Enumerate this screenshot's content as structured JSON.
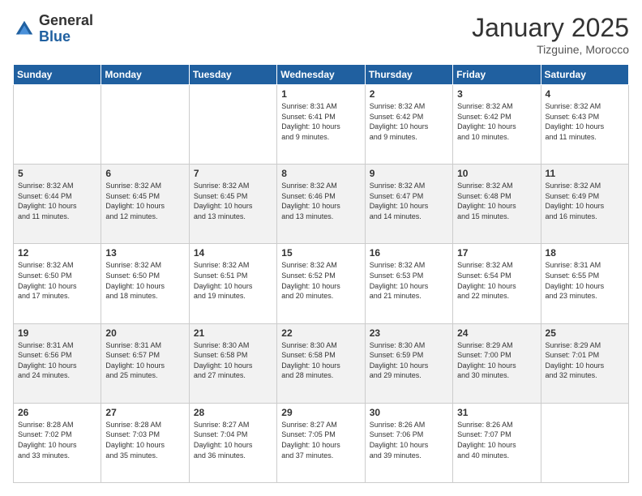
{
  "header": {
    "logo_general": "General",
    "logo_blue": "Blue",
    "month_title": "January 2025",
    "location": "Tizguine, Morocco"
  },
  "days_of_week": [
    "Sunday",
    "Monday",
    "Tuesday",
    "Wednesday",
    "Thursday",
    "Friday",
    "Saturday"
  ],
  "weeks": [
    {
      "shaded": false,
      "days": [
        {
          "num": "",
          "info": ""
        },
        {
          "num": "",
          "info": ""
        },
        {
          "num": "",
          "info": ""
        },
        {
          "num": "1",
          "info": "Sunrise: 8:31 AM\nSunset: 6:41 PM\nDaylight: 10 hours\nand 9 minutes."
        },
        {
          "num": "2",
          "info": "Sunrise: 8:32 AM\nSunset: 6:42 PM\nDaylight: 10 hours\nand 9 minutes."
        },
        {
          "num": "3",
          "info": "Sunrise: 8:32 AM\nSunset: 6:42 PM\nDaylight: 10 hours\nand 10 minutes."
        },
        {
          "num": "4",
          "info": "Sunrise: 8:32 AM\nSunset: 6:43 PM\nDaylight: 10 hours\nand 11 minutes."
        }
      ]
    },
    {
      "shaded": true,
      "days": [
        {
          "num": "5",
          "info": "Sunrise: 8:32 AM\nSunset: 6:44 PM\nDaylight: 10 hours\nand 11 minutes."
        },
        {
          "num": "6",
          "info": "Sunrise: 8:32 AM\nSunset: 6:45 PM\nDaylight: 10 hours\nand 12 minutes."
        },
        {
          "num": "7",
          "info": "Sunrise: 8:32 AM\nSunset: 6:45 PM\nDaylight: 10 hours\nand 13 minutes."
        },
        {
          "num": "8",
          "info": "Sunrise: 8:32 AM\nSunset: 6:46 PM\nDaylight: 10 hours\nand 13 minutes."
        },
        {
          "num": "9",
          "info": "Sunrise: 8:32 AM\nSunset: 6:47 PM\nDaylight: 10 hours\nand 14 minutes."
        },
        {
          "num": "10",
          "info": "Sunrise: 8:32 AM\nSunset: 6:48 PM\nDaylight: 10 hours\nand 15 minutes."
        },
        {
          "num": "11",
          "info": "Sunrise: 8:32 AM\nSunset: 6:49 PM\nDaylight: 10 hours\nand 16 minutes."
        }
      ]
    },
    {
      "shaded": false,
      "days": [
        {
          "num": "12",
          "info": "Sunrise: 8:32 AM\nSunset: 6:50 PM\nDaylight: 10 hours\nand 17 minutes."
        },
        {
          "num": "13",
          "info": "Sunrise: 8:32 AM\nSunset: 6:50 PM\nDaylight: 10 hours\nand 18 minutes."
        },
        {
          "num": "14",
          "info": "Sunrise: 8:32 AM\nSunset: 6:51 PM\nDaylight: 10 hours\nand 19 minutes."
        },
        {
          "num": "15",
          "info": "Sunrise: 8:32 AM\nSunset: 6:52 PM\nDaylight: 10 hours\nand 20 minutes."
        },
        {
          "num": "16",
          "info": "Sunrise: 8:32 AM\nSunset: 6:53 PM\nDaylight: 10 hours\nand 21 minutes."
        },
        {
          "num": "17",
          "info": "Sunrise: 8:32 AM\nSunset: 6:54 PM\nDaylight: 10 hours\nand 22 minutes."
        },
        {
          "num": "18",
          "info": "Sunrise: 8:31 AM\nSunset: 6:55 PM\nDaylight: 10 hours\nand 23 minutes."
        }
      ]
    },
    {
      "shaded": true,
      "days": [
        {
          "num": "19",
          "info": "Sunrise: 8:31 AM\nSunset: 6:56 PM\nDaylight: 10 hours\nand 24 minutes."
        },
        {
          "num": "20",
          "info": "Sunrise: 8:31 AM\nSunset: 6:57 PM\nDaylight: 10 hours\nand 25 minutes."
        },
        {
          "num": "21",
          "info": "Sunrise: 8:30 AM\nSunset: 6:58 PM\nDaylight: 10 hours\nand 27 minutes."
        },
        {
          "num": "22",
          "info": "Sunrise: 8:30 AM\nSunset: 6:58 PM\nDaylight: 10 hours\nand 28 minutes."
        },
        {
          "num": "23",
          "info": "Sunrise: 8:30 AM\nSunset: 6:59 PM\nDaylight: 10 hours\nand 29 minutes."
        },
        {
          "num": "24",
          "info": "Sunrise: 8:29 AM\nSunset: 7:00 PM\nDaylight: 10 hours\nand 30 minutes."
        },
        {
          "num": "25",
          "info": "Sunrise: 8:29 AM\nSunset: 7:01 PM\nDaylight: 10 hours\nand 32 minutes."
        }
      ]
    },
    {
      "shaded": false,
      "days": [
        {
          "num": "26",
          "info": "Sunrise: 8:28 AM\nSunset: 7:02 PM\nDaylight: 10 hours\nand 33 minutes."
        },
        {
          "num": "27",
          "info": "Sunrise: 8:28 AM\nSunset: 7:03 PM\nDaylight: 10 hours\nand 35 minutes."
        },
        {
          "num": "28",
          "info": "Sunrise: 8:27 AM\nSunset: 7:04 PM\nDaylight: 10 hours\nand 36 minutes."
        },
        {
          "num": "29",
          "info": "Sunrise: 8:27 AM\nSunset: 7:05 PM\nDaylight: 10 hours\nand 37 minutes."
        },
        {
          "num": "30",
          "info": "Sunrise: 8:26 AM\nSunset: 7:06 PM\nDaylight: 10 hours\nand 39 minutes."
        },
        {
          "num": "31",
          "info": "Sunrise: 8:26 AM\nSunset: 7:07 PM\nDaylight: 10 hours\nand 40 minutes."
        },
        {
          "num": "",
          "info": ""
        }
      ]
    }
  ]
}
